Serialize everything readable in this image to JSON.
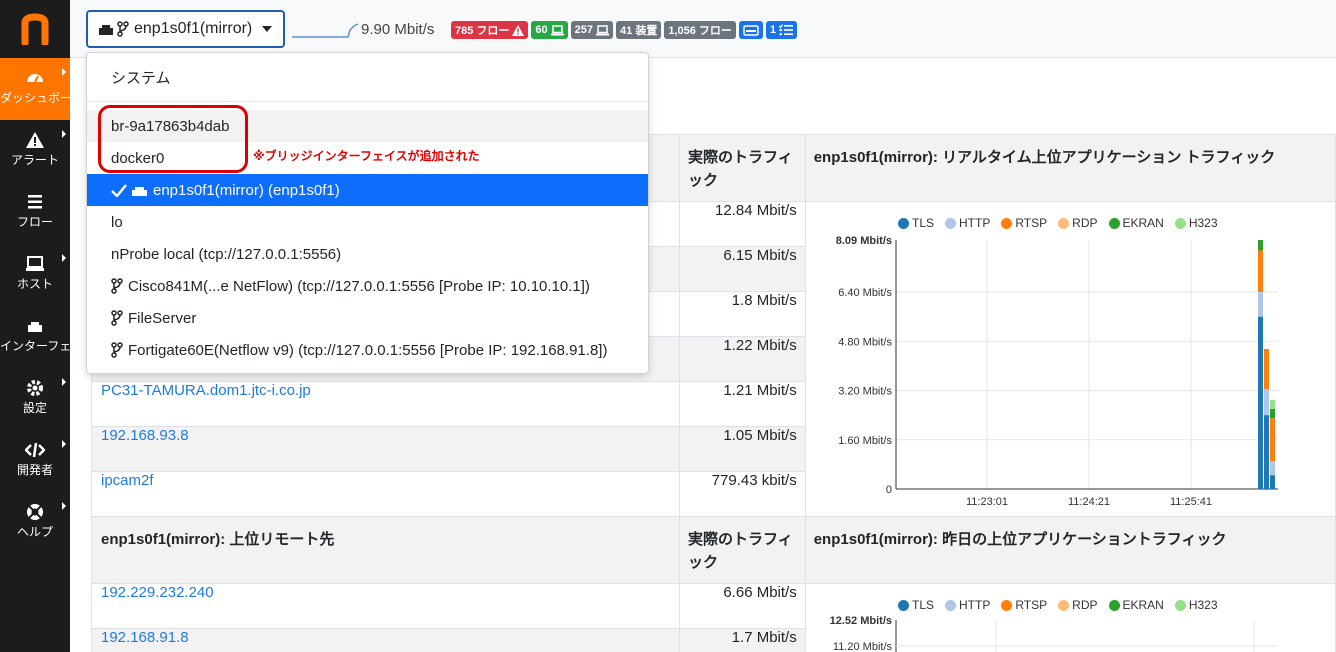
{
  "sidebar": {
    "logo": "n",
    "items": [
      {
        "label": "ダッシュボード",
        "icon": "gauge-icon"
      },
      {
        "label": "アラート",
        "icon": "warning-icon"
      },
      {
        "label": "フロー",
        "icon": "list-icon"
      },
      {
        "label": "ホスト",
        "icon": "laptop-icon"
      },
      {
        "label": "インターフェイス",
        "icon": "ethernet-icon"
      },
      {
        "label": "設定",
        "icon": "gear-icon"
      },
      {
        "label": "開発者",
        "icon": "code-icon"
      },
      {
        "label": "ヘルプ",
        "icon": "lifebuoy-icon"
      }
    ]
  },
  "topbar": {
    "interface_selector": "enp1s0f1(mirror)",
    "throughput": "9.90 Mbit/s",
    "badges": [
      {
        "text": "785 フロー",
        "icon": "warning-icon",
        "color": "#dc3545"
      },
      {
        "text": "60",
        "icon": "laptop-icon",
        "color": "#28a745"
      },
      {
        "text": "257",
        "icon": "laptop-icon",
        "color": "#6c757d"
      },
      {
        "text": "41 装置",
        "icon": "",
        "color": "#6c757d"
      },
      {
        "text": "1,056 フロー",
        "icon": "",
        "color": "#6c757d"
      },
      {
        "text": "",
        "icon": "ethernet-icon",
        "color": "#1a73e8"
      },
      {
        "text": "1",
        "icon": "list-check-icon",
        "color": "#1a73e8"
      }
    ]
  },
  "dropdown": {
    "header": "システム",
    "items": [
      {
        "label": "br-9a17863b4dab",
        "icon": ""
      },
      {
        "label": "docker0",
        "icon": ""
      },
      {
        "label": "enp1s0f1(mirror) (enp1s0f1)",
        "icon": "ethernet-icon",
        "selected": true
      },
      {
        "label": "lo",
        "icon": ""
      },
      {
        "label": "nProbe local (tcp://127.0.0.1:5556)",
        "icon": ""
      },
      {
        "label": "Cisco841M(...e NetFlow) (tcp://127.0.0.1:5556 [Probe IP: 10.10.10.1])",
        "icon": "branch-icon"
      },
      {
        "label": "FileServer",
        "icon": "branch-icon"
      },
      {
        "label": "Fortigate60E(Netflow v9) (tcp://127.0.0.1:5556 [Probe IP: 192.168.91.8])",
        "icon": "branch-icon"
      }
    ],
    "annotation": "※ブリッジインターフェイスが追加された"
  },
  "table1": {
    "header_col2": "実際のトラフィック",
    "header_col3": "enp1s0f1(mirror): リアルタイム上位アプリケーション トラフィック",
    "rows": [
      {
        "host": "",
        "traffic": "12.84 Mbit/s"
      },
      {
        "host": "",
        "traffic": "6.15 Mbit/s"
      },
      {
        "host": "",
        "traffic": "1.8 Mbit/s"
      },
      {
        "host": "",
        "traffic": "1.22 Mbit/s"
      },
      {
        "host": "PC31-TAMURA.dom1.jtc-i.co.jp",
        "traffic": "1.21 Mbit/s"
      },
      {
        "host": "192.168.93.8",
        "traffic": "1.05 Mbit/s"
      },
      {
        "host": "ipcam2f",
        "traffic": "779.43 kbit/s"
      }
    ]
  },
  "table2": {
    "header_col1": "enp1s0f1(mirror): 上位リモート先",
    "header_col2": "実際のトラフィック",
    "header_col3": "enp1s0f1(mirror): 昨日の上位アプリケーショントラフィック",
    "rows": [
      {
        "host": "192.229.232.240",
        "traffic": "6.66 Mbit/s"
      },
      {
        "host": "192.168.91.8",
        "traffic": "1.7 Mbit/s"
      }
    ]
  },
  "chart_data": [
    {
      "type": "bar",
      "stacked": true,
      "legend": [
        "TLS",
        "HTTP",
        "RTSP",
        "RDP",
        "EKRAN",
        "H323"
      ],
      "colors": [
        "#1f77b4",
        "#aec7e8",
        "#ff7f0e",
        "#ffbb78",
        "#2ca02c",
        "#98df8a"
      ],
      "y_ticks": [
        "8.09 Mbit/s",
        "6.40 Mbit/s",
        "4.80 Mbit/s",
        "3.20 Mbit/s",
        "1.60 Mbit/s",
        "0"
      ],
      "ylim": [
        0,
        8.09
      ],
      "x_ticks": [
        "11:23:01",
        "11:24:21",
        "11:25:41"
      ],
      "series": [
        {
          "name": "TLS",
          "values": [
            5.6,
            2.4,
            0.45
          ]
        },
        {
          "name": "HTTP",
          "values": [
            0.8,
            0.85,
            0.45
          ]
        },
        {
          "name": "RTSP",
          "values": [
            1.35,
            1.3,
            1.4
          ]
        },
        {
          "name": "RDP",
          "values": [
            0.0,
            0.0,
            0.0
          ]
        },
        {
          "name": "EKRAN",
          "values": [
            0.34,
            0.0,
            0.3
          ]
        },
        {
          "name": "H323",
          "values": [
            0.0,
            0.0,
            0.3
          ]
        }
      ]
    },
    {
      "type": "bar",
      "stacked": true,
      "legend": [
        "TLS",
        "HTTP",
        "RTSP",
        "RDP",
        "EKRAN",
        "H323"
      ],
      "colors": [
        "#1f77b4",
        "#aec7e8",
        "#ff7f0e",
        "#ffbb78",
        "#2ca02c",
        "#98df8a"
      ],
      "y_ticks": [
        "12.52 Mbit/s",
        "11.20 Mbit/s"
      ],
      "ylim": [
        0,
        12.52
      ]
    }
  ]
}
